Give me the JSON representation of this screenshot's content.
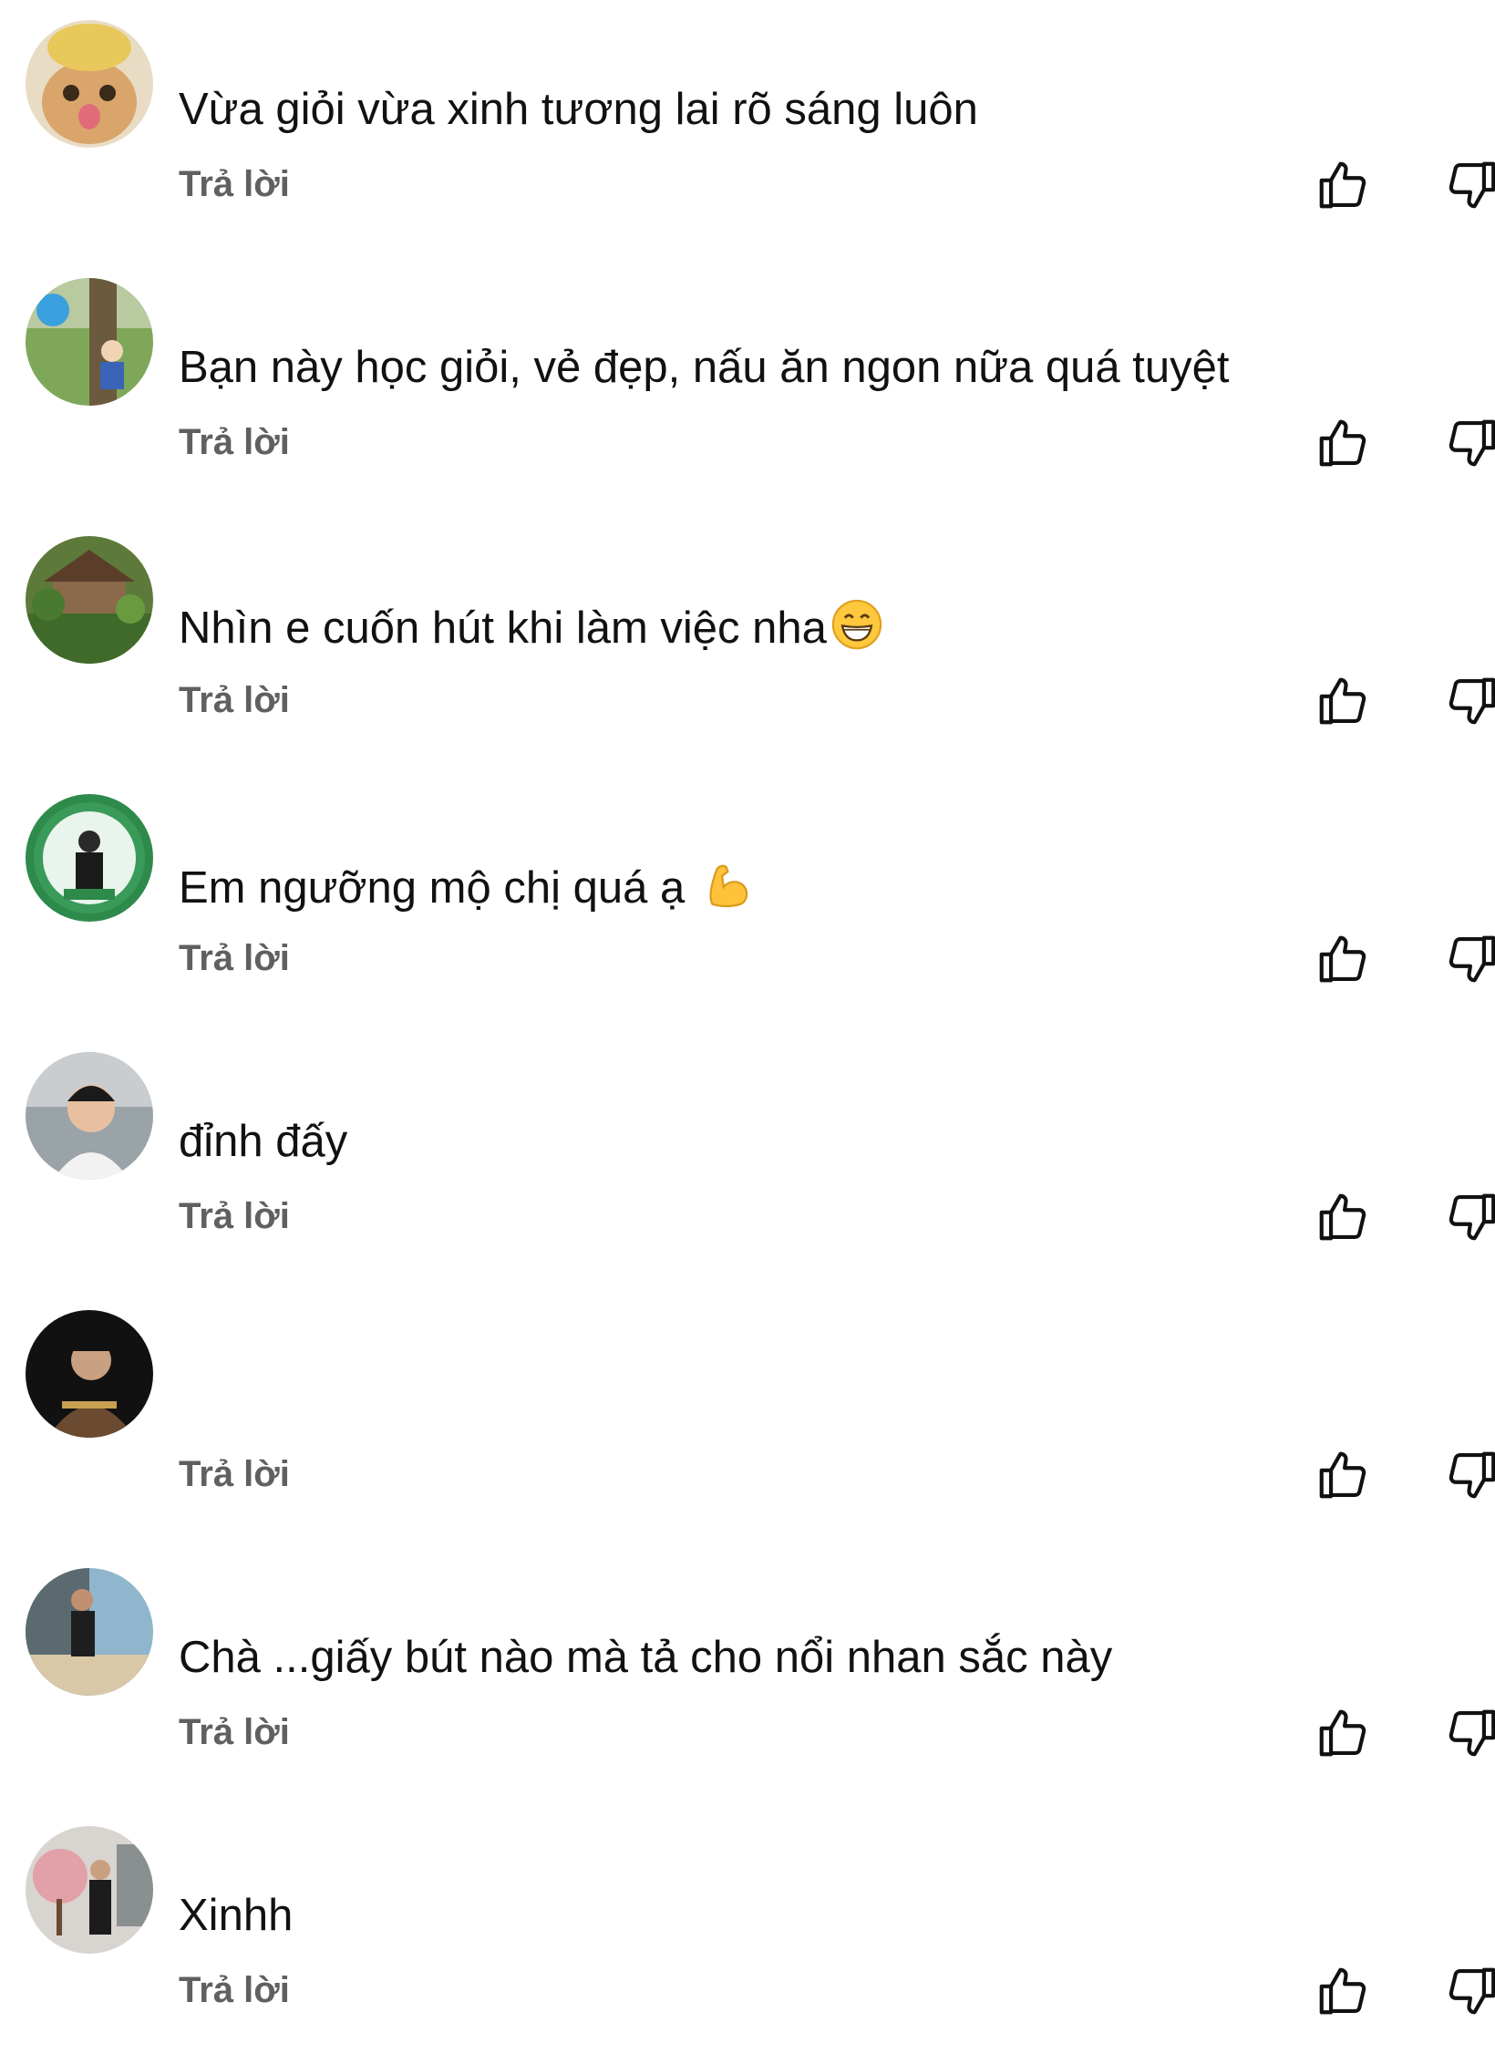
{
  "comments": [
    {
      "text": "Vừa giỏi vừa xinh tương lai rõ sáng luôn",
      "emoji": "",
      "reply_label": "Trả lời",
      "avatar": "cat-avatar"
    },
    {
      "text": "Bạn này học giỏi, vẻ đẹp, nấu ăn ngon nữa quá tuyệt",
      "emoji": "",
      "reply_label": "Trả lời",
      "avatar": "park-photo-avatar"
    },
    {
      "text": "Nhìn e cuốn hút  khi làm việc nha",
      "emoji": "grinning-face",
      "reply_label": "Trả lời",
      "avatar": "garden-house-avatar"
    },
    {
      "text": "Em ngưỡng mộ chị quá ạ ",
      "emoji": "flexed-biceps",
      "reply_label": "Trả lời",
      "avatar": "esgc-badge-avatar"
    },
    {
      "text": "đỉnh đấy",
      "emoji": "",
      "reply_label": "Trả lời",
      "avatar": "man-portrait-avatar"
    },
    {
      "text": "",
      "emoji": "",
      "reply_label": "Trả lời",
      "avatar": "dark-portrait-avatar"
    },
    {
      "text": "Chà ...giấy bút nào mà tả cho nổi nhan sắc này",
      "emoji": "",
      "reply_label": "Trả lời",
      "avatar": "beach-photo-avatar"
    },
    {
      "text": "Xinhh",
      "emoji": "",
      "reply_label": "Trả lời",
      "avatar": "blossom-photo-avatar"
    }
  ],
  "icons": {
    "like": "thumbs-up-icon",
    "dislike": "thumbs-down-icon"
  },
  "colors": {
    "text": "#111111",
    "reply": "#606060",
    "background": "#ffffff"
  }
}
